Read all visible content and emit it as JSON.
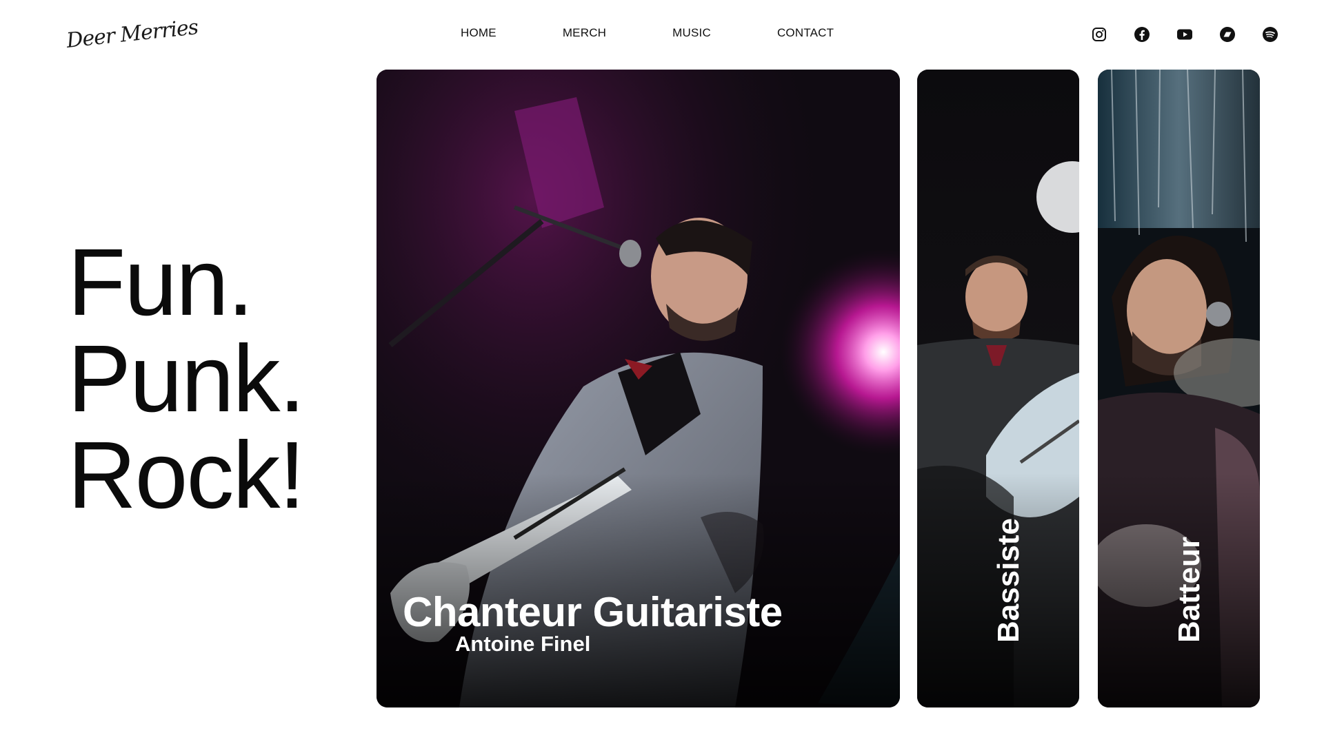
{
  "header": {
    "logo_text": "Deer Merries",
    "nav": [
      {
        "label": "HOME"
      },
      {
        "label": "MERCH"
      },
      {
        "label": "MUSIC"
      },
      {
        "label": "CONTACT"
      }
    ],
    "socials": [
      {
        "icon": "instagram-icon"
      },
      {
        "icon": "facebook-icon"
      },
      {
        "icon": "youtube-icon"
      },
      {
        "icon": "bandcamp-icon"
      },
      {
        "icon": "spotify-icon"
      }
    ]
  },
  "hero": {
    "lines": [
      "Fun.",
      "Punk.",
      "Rock!"
    ]
  },
  "cards": {
    "main": {
      "role": "Chanteur Guitariste",
      "name": "Antoine Finel"
    },
    "bass": {
      "role": "Bassiste"
    },
    "drums": {
      "role": "Batteur"
    }
  },
  "colors": {
    "text": "#0b0b0b",
    "card_dark": "#0d0a10",
    "stage_magenta": "#e01bb0",
    "white": "#ffffff"
  }
}
